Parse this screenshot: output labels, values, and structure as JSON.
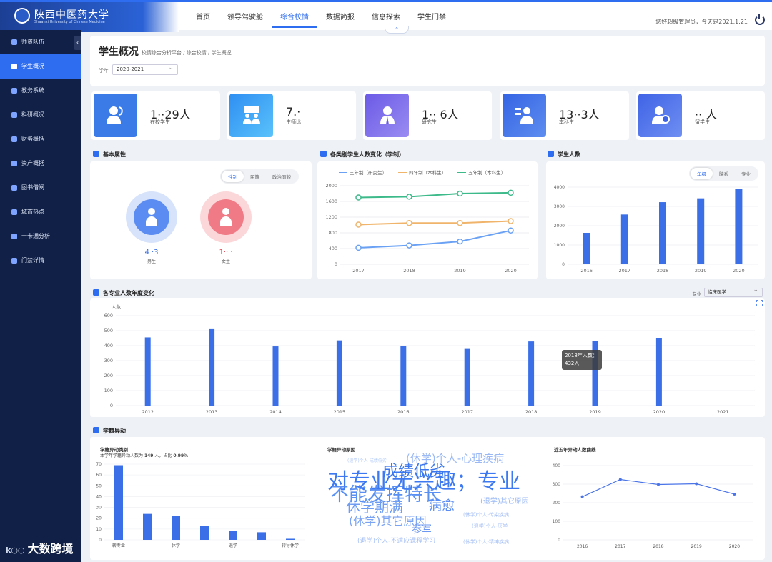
{
  "app": {
    "logo_text": "陕西中医药大学",
    "logo_sub": "Shaanxi University of Chinese Medicine"
  },
  "nav": [
    "首页",
    "领导驾驶舱",
    "综合校情",
    "数据简报",
    "信息探索",
    "学生门禁"
  ],
  "greeting": "您好超级管理员，今天是2021.1.21",
  "sidebar": [
    "师资队伍",
    "学生概况",
    "教务系统",
    "科研概况",
    "财务概括",
    "资产概括",
    "图书借阅",
    "城市热点",
    "一卡通分析",
    "门禁详情"
  ],
  "watermark": "大数跨境",
  "page": {
    "title": "学生概况",
    "breadcrumb": "校情综合分析平台 / 综合校情 / 学生概况",
    "year_label": "学年",
    "year_value": "2020-2021"
  },
  "stats": [
    {
      "num": "1··29人",
      "label": "在校学生",
      "color": "#3a7be8"
    },
    {
      "num": "7.·",
      "label": "生师比",
      "color": "#3aa7f5"
    },
    {
      "num": "1·· 6人",
      "label": "研究生",
      "color": "#7e68e8"
    },
    {
      "num": "13··3人",
      "label": "本科生",
      "color": "#3f6ee6"
    },
    {
      "num": "·· 人",
      "label": "留学生",
      "color": "#4b72e8"
    }
  ],
  "basic": {
    "title": "基本属性",
    "tabs": [
      "性别",
      "民族",
      "政治面貌"
    ],
    "male_num": "4 ·3",
    "male_label": "男生",
    "female_num": "1·· ·",
    "female_label": "女生"
  },
  "change": {
    "title": "各类别学生人数变化（学制）"
  },
  "count": {
    "title": "学生人数",
    "tabs": [
      "年级",
      "院系",
      "专业"
    ]
  },
  "major": {
    "title": "各专业人数年度变化",
    "select_label": "专业",
    "select_value": "临床医学",
    "tooltip_l1": "2018年人数：",
    "tooltip_l2": "432人"
  },
  "change2": {
    "title": "学籍异动",
    "c1_title": "学籍异动类别",
    "c1_desc1": "本学年学籍异动人数为",
    "c1_num": "149",
    "c1_desc2": "人，占比",
    "c1_pct": "0.99%",
    "c2_title": "学籍异动原因",
    "c3_title": "近五年异动人数曲线"
  },
  "wordcloud": [
    {
      "t": "对专业无兴趣；专业",
      "s": 30,
      "c": "#2d6ff0"
    },
    {
      "t": "不能发挥特长",
      "s": 26,
      "c": "#4c87f2"
    },
    {
      "t": "成绩低劣",
      "s": 22,
      "c": "#3a77ee"
    },
    {
      "t": "(休学)个人-心理疾病",
      "s": 15,
      "c": "#9bb9f5"
    },
    {
      "t": "休学期满",
      "s": 20,
      "c": "#6e9cf3"
    },
    {
      "t": "病愈",
      "s": 18,
      "c": "#5b8df2"
    },
    {
      "t": "(休学)其它原因",
      "s": 16,
      "c": "#7aa3f4"
    },
    {
      "t": "参军",
      "s": 14,
      "c": "#6d98f2"
    },
    {
      "t": "(退学)其它原因",
      "s": 10,
      "c": "#9bb9f5"
    },
    {
      "t": "(退学)个人-不适应课程学习",
      "s": 9,
      "c": "#a8c2f6"
    },
    {
      "t": "(休学)个人-传染疾病",
      "s": 7,
      "c": "#a8c2f6"
    },
    {
      "t": "(退学)个人-厌学",
      "s": 7,
      "c": "#a8c2f6"
    },
    {
      "t": "(休学)个人-精神疾病",
      "s": 7,
      "c": "#a8c2f6"
    },
    {
      "t": "(退学)个人-成绩低劣",
      "s": 6,
      "c": "#b5ccf7"
    }
  ],
  "chart_data": [
    {
      "type": "line",
      "title": "各类别学生人数变化（学制）",
      "categories": [
        "2017",
        "2018",
        "2019",
        "2020"
      ],
      "ylim": [
        0,
        2000
      ],
      "yticks": [
        0,
        400,
        800,
        1200,
        1600,
        2000
      ],
      "series": [
        {
          "name": "三年制（研究生）",
          "values": [
            420,
            480,
            580,
            860
          ],
          "color": "#6aa1f4"
        },
        {
          "name": "四年制（本科生）",
          "values": [
            1010,
            1050,
            1050,
            1100
          ],
          "color": "#f0b46b"
        },
        {
          "name": "五年制（本科生）",
          "values": [
            1700,
            1720,
            1800,
            1820
          ],
          "color": "#3dba8a"
        }
      ]
    },
    {
      "type": "bar",
      "title": "学生人数",
      "categories": [
        "2016",
        "2017",
        "2018",
        "2019",
        "2020"
      ],
      "values": [
        1630,
        2580,
        3220,
        3420,
        3900
      ],
      "ylim": [
        0,
        4000
      ],
      "yticks": [
        0,
        1000,
        2000,
        3000,
        4000
      ]
    },
    {
      "type": "bar",
      "title": "各专业人数年度变化",
      "ylabel": "人数",
      "categories": [
        "2012",
        "2013",
        "2014",
        "2015",
        "2016",
        "2017",
        "2018",
        "2019",
        "2020",
        "2021"
      ],
      "values": [
        455,
        510,
        395,
        435,
        400,
        378,
        428,
        432,
        448,
        null
      ],
      "ylim": [
        0,
        600
      ],
      "yticks": [
        0,
        100,
        200,
        300,
        400,
        500,
        600
      ]
    },
    {
      "type": "bar",
      "title": "学籍异动类别",
      "categories": [
        "转专业",
        "",
        "休学",
        "",
        "退学",
        "",
        "转导休学"
      ],
      "values": [
        69,
        24,
        22,
        13,
        8,
        7,
        1
      ],
      "ylim": [
        0,
        70
      ],
      "yticks": [
        0,
        10,
        20,
        30,
        40,
        50,
        60,
        70
      ]
    },
    {
      "type": "line",
      "title": "近五年异动人数曲线",
      "categories": [
        "2016",
        "2017",
        "2018",
        "2019",
        "2020"
      ],
      "values": [
        232,
        325,
        298,
        302,
        246
      ],
      "ylim": [
        0,
        400
      ],
      "yticks": [
        0,
        100,
        200,
        300,
        400
      ]
    }
  ]
}
